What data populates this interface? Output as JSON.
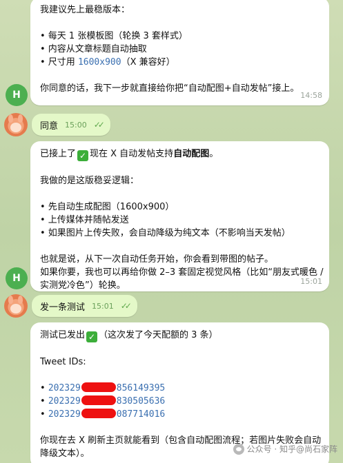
{
  "messages": [
    {
      "sender": "bot",
      "avatar_letter": "H",
      "lines": [
        "我建议先上最稳版本：",
        "",
        "• 每天 1 张模板图（轮换 3 套样式）",
        "• 内容从文章标题自动抽取",
        [
          "• 尺寸用 ",
          "1600x900",
          "（X 兼容好）"
        ],
        "",
        "你同意的话，我下一步就直接给你把“自动配图+自动发帖”接上。"
      ],
      "time": "14:58"
    },
    {
      "sender": "user",
      "text": "同意",
      "time": "15:00"
    },
    {
      "sender": "bot",
      "avatar_letter": "H",
      "lines": {
        "l1_pre": "已接上了",
        "l1_check": "✓",
        "l1_mid": "现在 X 自动发帖支持",
        "l1_bold": "自动配图",
        "l1_end": "。",
        "l3": "我做的是这版稳妥逻辑：",
        "l5": "• 先自动生成配图（1600x900）",
        "l6": "• 上传媒体并随帖发送",
        "l7": "• 如果图片上传失败，会自动降级为纯文本（不影响当天发帖）",
        "l9": "也就是说，从下一次自动任务开始，你会看到带图的帖子。",
        "l10": "如果你要，我也可以再给你做 2–3 套固定视觉风格（比如“朋友式暖色 /",
        "l11": "实测党冷色”）轮换。"
      },
      "time": "15:01"
    },
    {
      "sender": "user",
      "text": "发一条测试",
      "time": "15:01"
    },
    {
      "sender": "bot",
      "avatar_letter": "H",
      "lines": {
        "l1_pre": "测试已发出",
        "l1_check": "✓",
        "l1_end": "（这次发了今天配额的 3 条）",
        "l3": "Tweet IDs:",
        "ids": [
          {
            "prefix": "202329",
            "suffix": "856149395"
          },
          {
            "prefix": "202329",
            "suffix": "830505636"
          },
          {
            "prefix": "202329",
            "suffix": "087714016"
          }
        ],
        "l9": "你现在去 X 刷新主页就能看到（包含自动配图流程；若图片失败会自动",
        "l10": "降级文本）。"
      }
    }
  ],
  "watermark": "公众号 · 知乎@尚石家阵"
}
